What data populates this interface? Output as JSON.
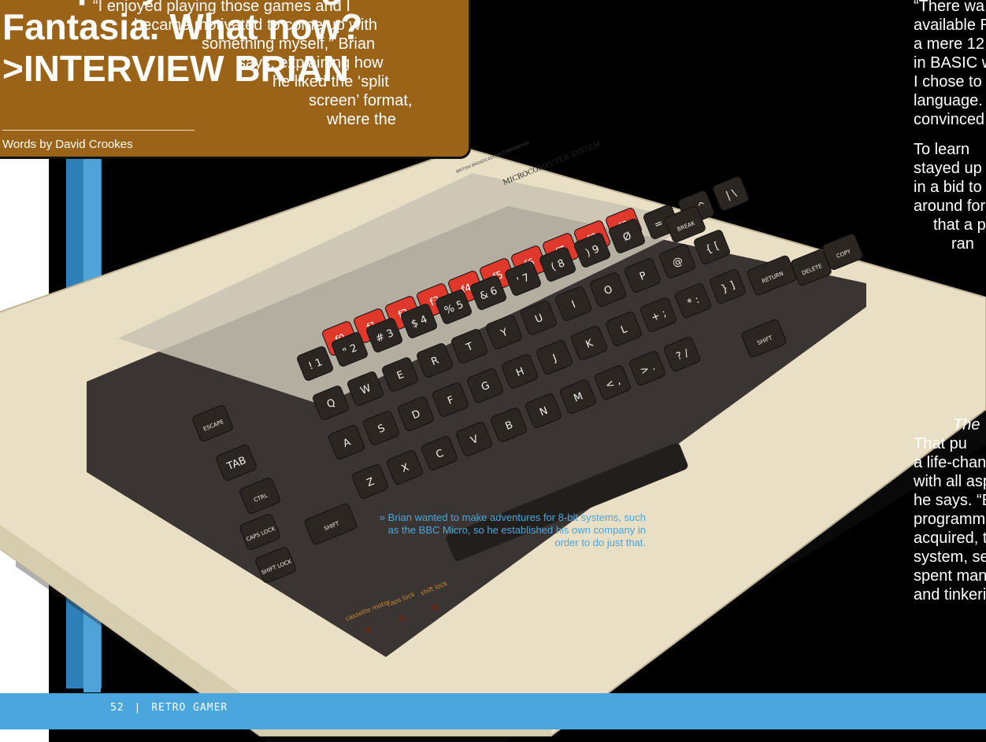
{
  "headline": "company called Digital\nFantasia. What now?\n>INTERVIEW BRIAN",
  "byline": "Words by David Crookes",
  "column1": [
    "“I enjoyed playing those games and I",
    "became motivated to come up with",
    "something myself,” Brian",
    "says, explaining how",
    "he liked the ‘split",
    "screen’ format,",
    "where the"
  ],
  "column2_top": [
    "“There wa",
    "available R",
    "a mere 12",
    "in BASIC w",
    "I chose to l",
    "language. T",
    "convinced",
    "  To learn",
    "stayed up",
    "in a bid to",
    "around for",
    "    that a p",
    "      ran"
  ],
  "column2_bottom_italic": "The",
  "column2_bottom": [
    "  That pu",
    "a life-chang",
    "with all asp",
    "he says. “E",
    "programm",
    "acquired, t",
    "system, se",
    "spent man",
    "and tinkeri"
  ],
  "caption": "» Brian wanted to make adventures for 8-bit systems, such as the BBC Micro, so he established his own company in order to do just that.",
  "folio": {
    "page": "52",
    "separator": "|",
    "magazine": "RETRO GAMER"
  },
  "computer": {
    "badge": "BRITISH BROADCASTING CORPORATION",
    "model": "MICROCOMPUTER SYSTEM",
    "fkeys": [
      "f0",
      "f1",
      "f2",
      "f3",
      "f4",
      "f5",
      "f6",
      "f7",
      "f8",
      "f9"
    ],
    "row1": [
      "!\n1",
      "\"\n2",
      "#\n3",
      "$\n4",
      "%\n5",
      "&\n6",
      "'\n7",
      "(\n8",
      ")\n9",
      "Ø",
      "=\n-",
      "~\n^",
      "|\n\\"
    ],
    "row2": [
      "Q",
      "W",
      "E",
      "R",
      "T",
      "Y",
      "U",
      "I",
      "O",
      "P",
      "@",
      "{\n["
    ],
    "row3": [
      "A",
      "S",
      "D",
      "F",
      "G",
      "H",
      "J",
      "K",
      "L",
      "+\n;",
      "*\n:",
      "}\n]"
    ],
    "row4": [
      "Z",
      "X",
      "C",
      "V",
      "B",
      "N",
      "M",
      "<\n,",
      ">\n.",
      "?\n/"
    ],
    "mods": [
      "ESCAPE",
      "TAB",
      "CTRL",
      "CAPS LOCK",
      "SHIFT LOCK",
      "SHIFT",
      "SHIFT",
      "RETURN",
      "DELETE",
      "COPY",
      "BREAK"
    ],
    "leds": [
      "cassette motor",
      "caps lock",
      "shift lock"
    ]
  },
  "colors": {
    "title_bg": "#9a6318",
    "page_bg": "#000000",
    "accent_blue": "#4aa6dc",
    "fkey_red": "#e0392b",
    "case_cream": "#e9dfc4",
    "key_dark": "#2b2622"
  }
}
